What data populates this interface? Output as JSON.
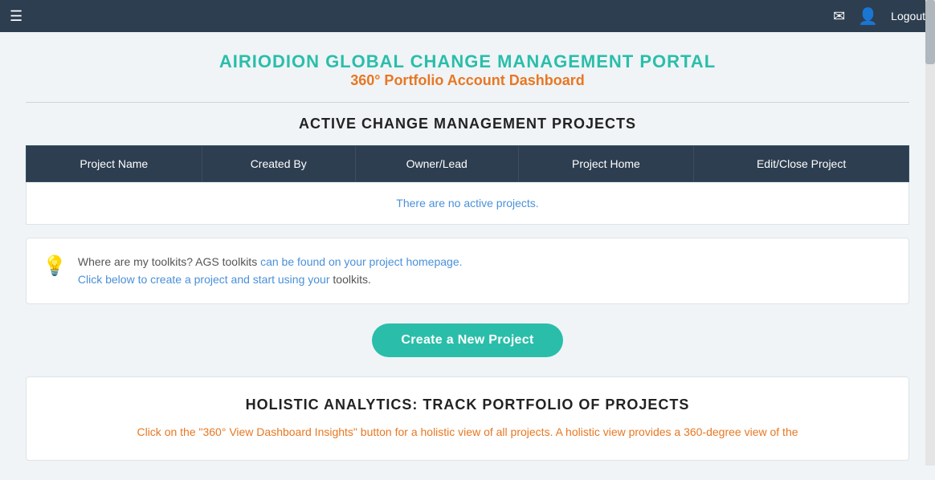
{
  "nav": {
    "hamburger_label": "☰",
    "mail_icon": "✉",
    "user_icon": "⊙",
    "logout_label": "Logout"
  },
  "portal": {
    "title_main": "AIRIODION GLOBAL CHANGE MANAGEMENT PORTAL",
    "title_sub": "360° Portfolio Account Dashboard"
  },
  "active_projects": {
    "section_heading": "ACTIVE CHANGE MANAGEMENT PROJECTS",
    "table": {
      "columns": [
        "Project Name",
        "Created By",
        "Owner/Lead",
        "Project Home",
        "Edit/Close Project"
      ],
      "empty_message": "There are no active projects."
    }
  },
  "toolkit": {
    "icon": "💡",
    "text_line1": "Where are my toolkits? AGS toolkits can be found on your project homepage.",
    "text_line2": "Click below to create a project and start using your toolkits."
  },
  "create_button": {
    "label": "Create a New Project"
  },
  "holistic": {
    "title": "HOLISTIC ANALYTICS: TRACK PORTFOLIO OF PROJECTS",
    "description": "Click on the \"360° View Dashboard Insights\" button for a holistic view of all projects. A holistic view provides a 360-degree view of the"
  }
}
